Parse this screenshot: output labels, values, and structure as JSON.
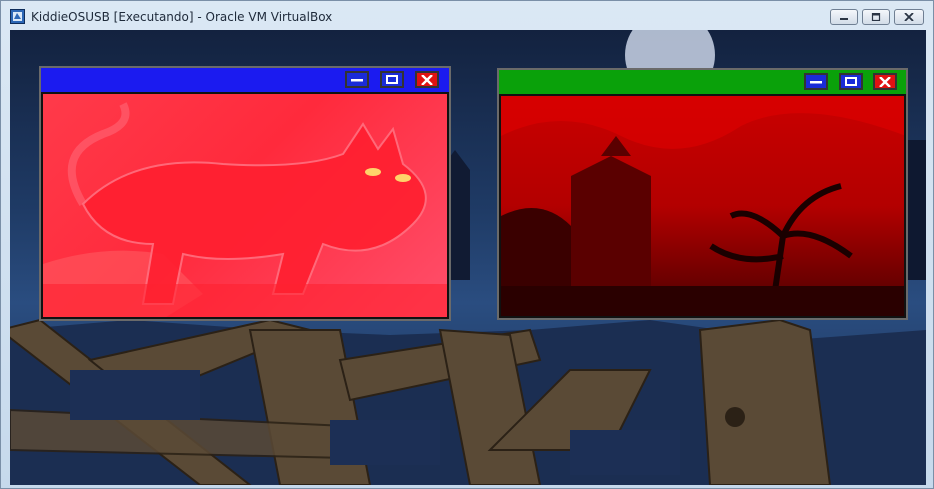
{
  "window": {
    "title": "KiddieOSUSB [Executando] - Oracle VM VirtualBox",
    "icons": {
      "app": "virtualbox-icon",
      "minimize": "minimize-icon",
      "maximize": "maximize-icon",
      "close": "close-icon"
    }
  },
  "guest": {
    "windows": [
      {
        "id": "left",
        "titlebar_color": "#1b1bf0",
        "content": "pink cat image",
        "buttons": [
          "minimize-icon",
          "maximize-icon",
          "close-icon"
        ]
      },
      {
        "id": "right",
        "titlebar_color": "#0aa10a",
        "content": "red haunted tree image",
        "buttons": [
          "minimize-icon",
          "maximize-icon",
          "close-icon"
        ]
      }
    ]
  }
}
